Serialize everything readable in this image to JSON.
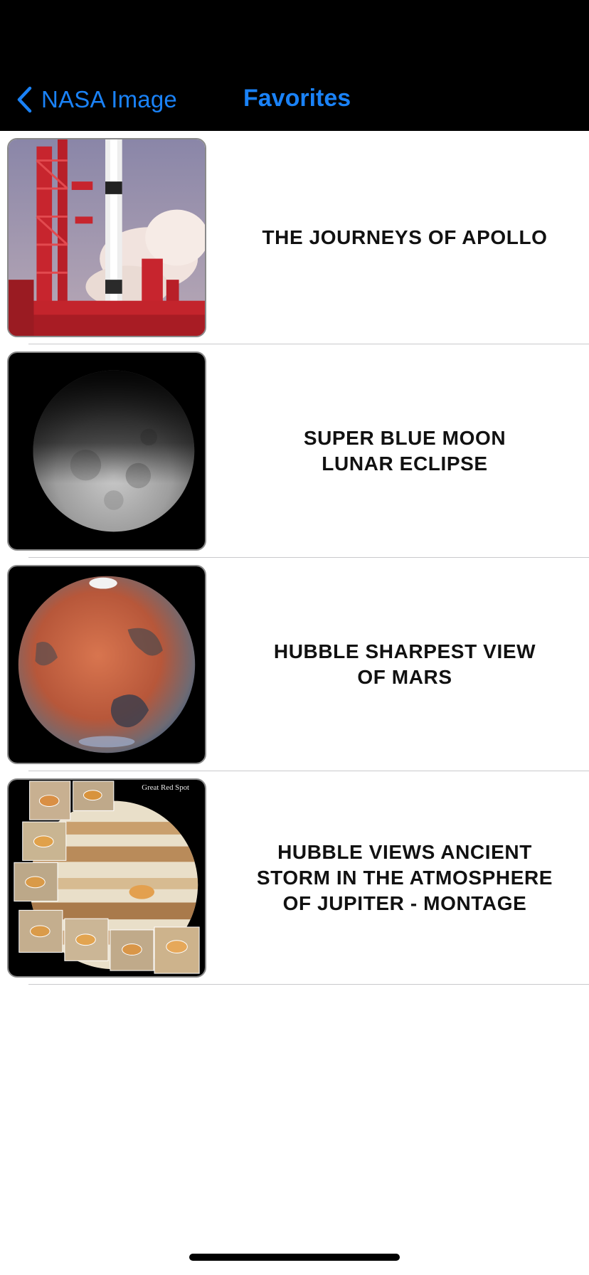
{
  "navbar": {
    "back_label": "NASA Image",
    "title": "Favorites",
    "accent_color": "#1a82f7",
    "back_icon": "chevron-left-icon"
  },
  "favorites": [
    {
      "title": "THE JOURNEYS OF APOLLO",
      "thumbnail": "apollo-launch-image"
    },
    {
      "title": "SUPER BLUE MOON\nLUNAR ECLIPSE",
      "thumbnail": "moon-eclipse-image"
    },
    {
      "title": "HUBBLE SHARPEST VIEW\nOF MARS",
      "thumbnail": "mars-image"
    },
    {
      "title": "HUBBLE VIEWS ANCIENT\nSTORM IN THE ATMOSPHERE\nOF JUPITER - MONTAGE",
      "thumbnail": "jupiter-montage-image",
      "thumbnail_caption": "Great Red Spot"
    }
  ]
}
